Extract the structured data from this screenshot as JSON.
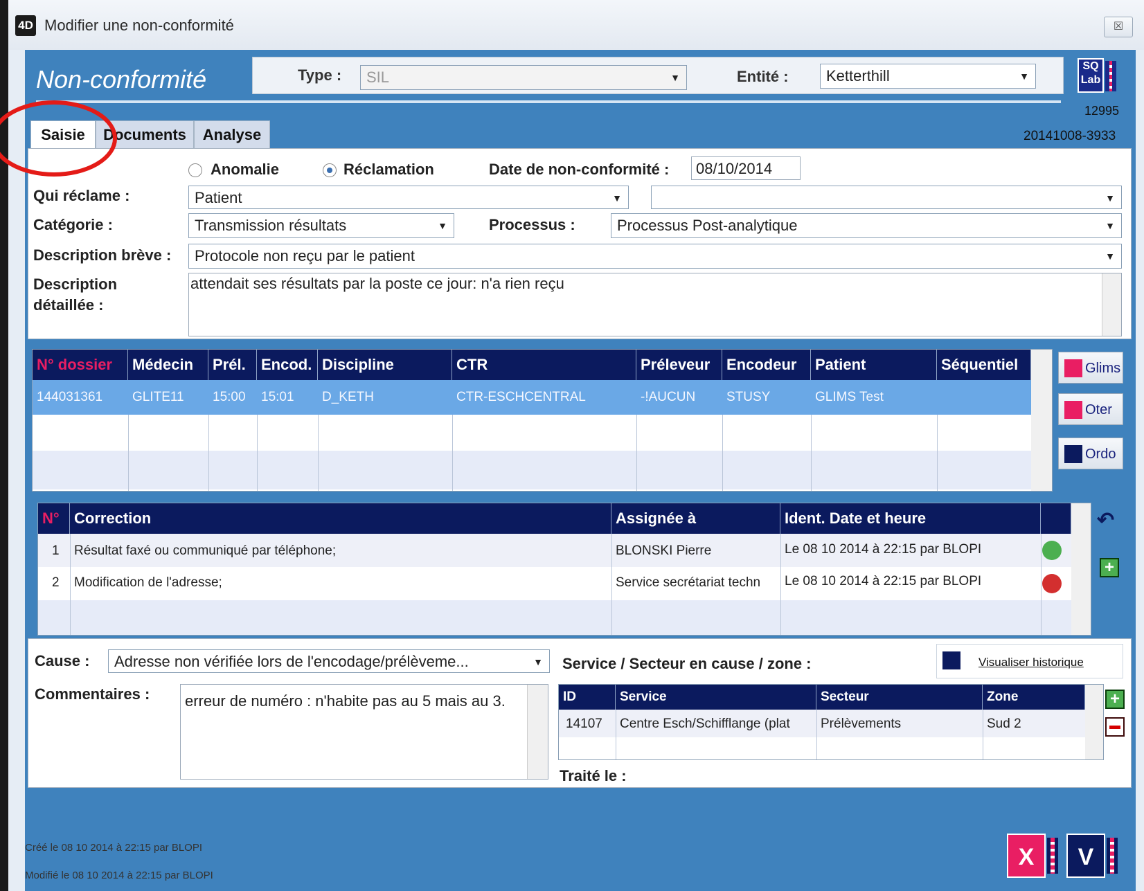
{
  "window": {
    "title": "Modifier une non-conformité",
    "app_icon": "4D",
    "close_glyph": "☒"
  },
  "header": {
    "title": "Non-conformité",
    "type_label": "Type :",
    "type_value": "SIL",
    "entity_label": "Entité :",
    "entity_value": "Ketterthill",
    "logo_text": "SQ Lab",
    "record_number": "12995",
    "reference": "20141008-3933"
  },
  "tabs": [
    "Saisie",
    "Documents",
    "Analyse"
  ],
  "form": {
    "radio_anomalie": "Anomalie",
    "radio_reclamation": "Réclamation",
    "selected_radio": "Réclamation",
    "date_label": "Date de non-conformité :",
    "date_value": "08/10/2014",
    "qui_label": "Qui réclame :",
    "qui_value": "Patient",
    "qui_value2": "",
    "categorie_label": "Catégorie :",
    "categorie_value": "Transmission résultats",
    "processus_label": "Processus :",
    "processus_value": "Processus Post-analytique",
    "brief_label": "Description brève :",
    "brief_value": "Protocole non reçu par le patient",
    "detail_label_1": "Description",
    "detail_label_2": "détaillée :",
    "detail_value": "attendait ses résultats par la poste ce jour: n'a rien reçu"
  },
  "dossiers": {
    "columns": [
      "N° dossier",
      "Médecin",
      "Prél.",
      "Encod.",
      "Discipline",
      "CTR",
      "Préleveur",
      "Encodeur",
      "Patient",
      "Séquentiel"
    ],
    "rows": [
      [
        "144031361",
        "GLITE11",
        "15:00",
        "15:01",
        "D_KETH",
        "CTR-ESCHCENTRAL",
        "-!AUCUN",
        "STUSY",
        "GLIMS Test",
        ""
      ]
    ],
    "buttons": [
      "Glims",
      "Oter",
      "Ordo"
    ]
  },
  "corrections": {
    "columns": [
      "N°",
      "Correction",
      "Assignée à",
      "Ident. Date et heure",
      ""
    ],
    "rows": [
      {
        "num": "1",
        "correction": "Résultat faxé ou communiqué par téléphone;",
        "assignee": "BLONSKI Pierre",
        "ident": "Le 08 10 2014 à 22:15 par BLOPI",
        "status": "green"
      },
      {
        "num": "2",
        "correction": "Modification de l'adresse;",
        "assignee": "Service secrétariat techn",
        "ident": "Le 08 10 2014 à 22:15 par BLOPI",
        "status": "red"
      }
    ],
    "status_colors": {
      "green": "#4caf50",
      "red": "#d32f2f"
    }
  },
  "cause": {
    "label": "Cause :",
    "value": "Adresse non vérifiée lors de l'encodage/prélèveme...",
    "service_label": "Service / Secteur en cause / zone :",
    "history_link": "Visualiser historique",
    "comments_label": "Commentaires :",
    "comments_value": "erreur de numéro : n'habite pas au 5 mais au 3.",
    "treated_label": "Traité le  :"
  },
  "services": {
    "columns": [
      "ID",
      "Service",
      "Secteur",
      "Zone"
    ],
    "rows": [
      [
        "14107",
        "Centre Esch/Schifflange (plat",
        "Prélèvements",
        "Sud 2"
      ]
    ]
  },
  "footer": {
    "created": "Créé le 08 10 2014 à 22:15 par BLOPI",
    "modified": "Modifié le  08 10 2014 à 22:15 par BLOPI",
    "cancel_label": "X",
    "validate_label": "V"
  },
  "colors": {
    "frame_blue": "#3f82bd",
    "grid_header": "#0b1a5e",
    "selected_row": "#6aa8e6",
    "accent_pink": "#e91e63",
    "annotation_red": "#e41b17"
  }
}
